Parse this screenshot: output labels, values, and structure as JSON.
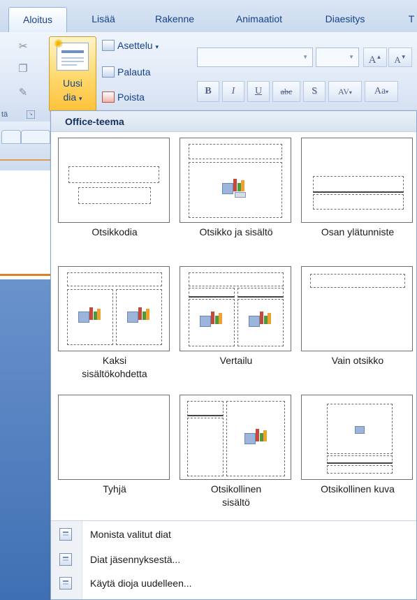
{
  "tabs": [
    {
      "label": "Aloitus",
      "active": true
    },
    {
      "label": "Lisää",
      "active": false
    },
    {
      "label": "Rakenne",
      "active": false
    },
    {
      "label": "Animaatiot",
      "active": false
    },
    {
      "label": "Diaesitys",
      "active": false
    },
    {
      "label": "T",
      "active": false
    }
  ],
  "ribbon": {
    "clipboard_group_label": "tä",
    "new_slide_line1": "Uusi",
    "new_slide_line2": "dia",
    "layout_button": "Asettelu",
    "reset_button": "Palauta",
    "delete_button": "Poista",
    "grow_font": "A",
    "shrink_font": "A",
    "format_buttons": [
      "B",
      "I",
      "U",
      "abc",
      "S",
      "AV",
      "Aa"
    ]
  },
  "dropdown": {
    "header": "Office-teema",
    "layouts": [
      {
        "name": "Otsikkodia"
      },
      {
        "name": "Otsikko ja sisältö"
      },
      {
        "name": "Osan ylätunniste"
      },
      {
        "name_line1": "Kaksi",
        "name_line2": "sisältökohdetta"
      },
      {
        "name": "Vertailu"
      },
      {
        "name": "Vain otsikko"
      },
      {
        "name": "Tyhjä"
      },
      {
        "name_line1": "Otsikollinen",
        "name_line2": "sisältö"
      },
      {
        "name": "Otsikollinen kuva"
      }
    ],
    "menu": [
      {
        "label": "Monista valitut diat"
      },
      {
        "label": "Diat jäsennyksestä..."
      },
      {
        "label": "Käytä dioja uudelleen..."
      }
    ]
  },
  "colors": {
    "tab_text": "#15428b",
    "ribbon_highlight": "#ffd86b",
    "dropdown_header_bg": "#dde6f2",
    "slide_pane_blue": "#4f7dbf"
  }
}
